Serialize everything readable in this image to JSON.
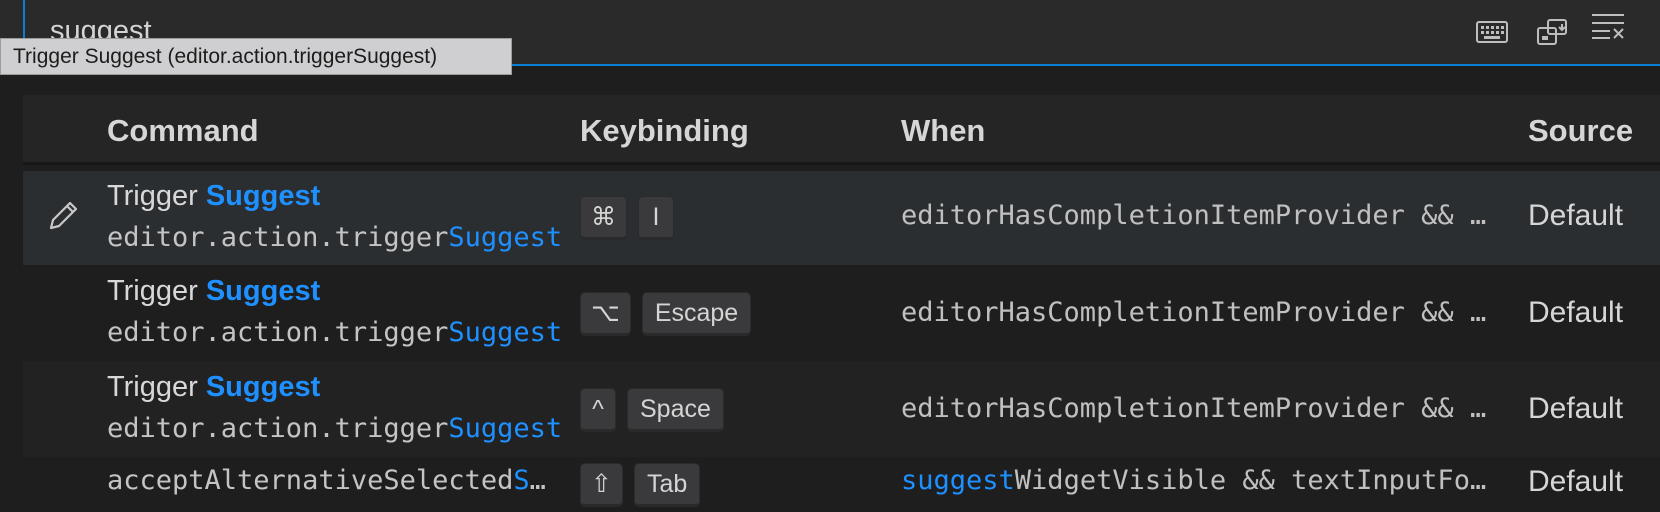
{
  "search": {
    "value": "suggest"
  },
  "toolbar": {
    "icons": [
      "keyboard-icon",
      "record-keys-icon",
      "clear-list-icon"
    ]
  },
  "tooltip": {
    "text": "Trigger Suggest (editor.action.triggerSuggest)"
  },
  "table": {
    "headers": {
      "command": "Command",
      "keybinding": "Keybinding",
      "when": "When",
      "source": "Source"
    },
    "rows": [
      {
        "title_pre": "Trigger ",
        "title_hl": "Suggest",
        "id_pre": "editor.action.trigger",
        "id_hl": "Suggest",
        "keys": [
          "⌘",
          "I"
        ],
        "when_hl": "",
        "when_rest": "editorHasCompletionItemProvider && …",
        "source": "Default"
      },
      {
        "title_pre": "Trigger ",
        "title_hl": "Suggest",
        "id_pre": "editor.action.trigger",
        "id_hl": "Suggest",
        "keys": [
          "⌥",
          "Escape"
        ],
        "when_hl": "",
        "when_rest": "editorHasCompletionItemProvider && …",
        "source": "Default"
      },
      {
        "title_pre": "Trigger ",
        "title_hl": "Suggest",
        "id_pre": "editor.action.trigger",
        "id_hl": "Suggest",
        "keys": [
          "^",
          "Space"
        ],
        "when_hl": "",
        "when_rest": "editorHasCompletionItemProvider && …",
        "source": "Default"
      },
      {
        "id_pre": "acceptAlternativeSelected",
        "id_hl": "S",
        "id_post": "…",
        "keys": [
          "⇧",
          "Tab"
        ],
        "when_hl": "suggest",
        "when_rest": "WidgetVisible && textInputFo…",
        "source": "Default"
      }
    ]
  },
  "colors": {
    "accent": "#0a7fd6",
    "highlight": "#1e90ff",
    "background": "#1e1e1f",
    "selected_row": "#2b2e31"
  }
}
